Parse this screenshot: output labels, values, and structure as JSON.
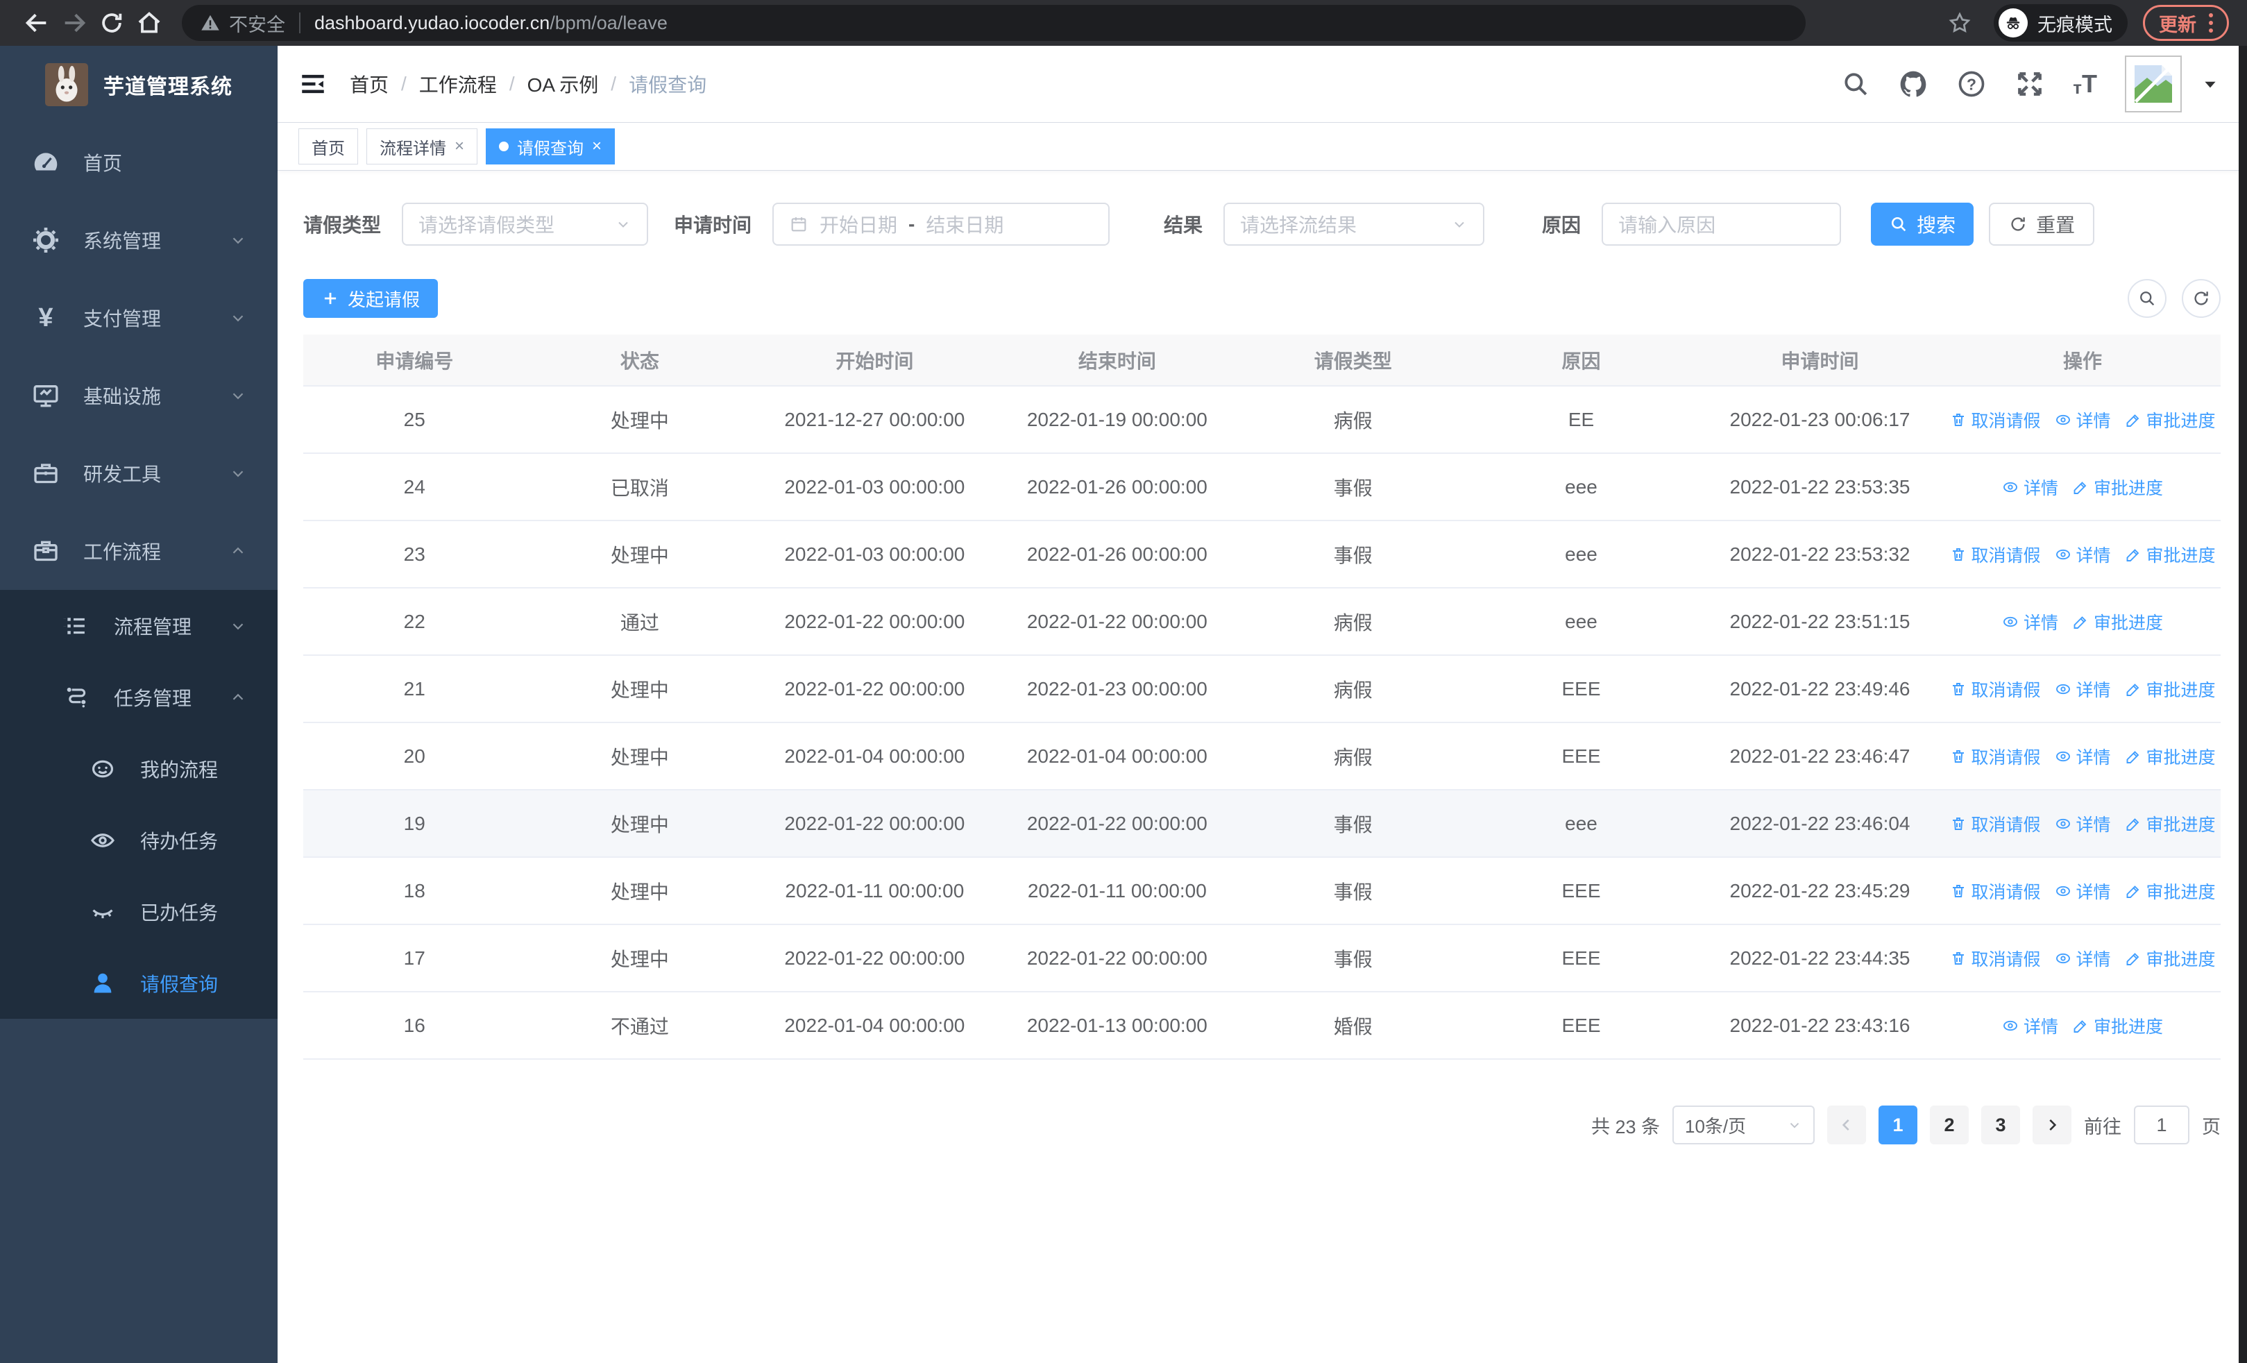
{
  "browser": {
    "security_label": "不安全",
    "url_domain": "dashboard.yudao.iocoder.cn",
    "url_path": "/bpm/oa/leave",
    "incognito_label": "无痕模式",
    "update_label": "更新"
  },
  "sidebar": {
    "title": "芋道管理系统",
    "items": [
      {
        "label": "首页",
        "icon": "dashboard-icon"
      },
      {
        "label": "系统管理",
        "icon": "gear-icon",
        "state": "collapsed"
      },
      {
        "label": "支付管理",
        "icon": "yen-icon",
        "state": "collapsed"
      },
      {
        "label": "基础设施",
        "icon": "monitor-icon",
        "state": "collapsed"
      },
      {
        "label": "研发工具",
        "icon": "toolbox-icon",
        "state": "collapsed"
      },
      {
        "label": "工作流程",
        "icon": "briefcase-icon",
        "state": "expanded"
      },
      {
        "label": "流程管理",
        "icon": "flow-list-icon",
        "state": "collapsed"
      },
      {
        "label": "任务管理",
        "icon": "org-icon",
        "state": "expanded"
      },
      {
        "label": "我的流程",
        "icon": "face-icon"
      },
      {
        "label": "待办任务",
        "icon": "eye-icon"
      },
      {
        "label": "已办任务",
        "icon": "eye-closed-icon"
      },
      {
        "label": "请假查询",
        "icon": "person-icon",
        "active": true
      }
    ]
  },
  "breadcrumb": [
    "首页",
    "工作流程",
    "OA 示例",
    "请假查询"
  ],
  "tabs": [
    {
      "label": "首页",
      "closable": false,
      "active": false
    },
    {
      "label": "流程详情",
      "closable": true,
      "active": false
    },
    {
      "label": "请假查询",
      "closable": true,
      "active": true
    }
  ],
  "close_glyph": "×",
  "filters": {
    "leave_type_label": "请假类型",
    "leave_type_placeholder": "请选择请假类型",
    "apply_time_label": "申请时间",
    "start_date_placeholder": "开始日期",
    "range_separator": "-",
    "end_date_placeholder": "结束日期",
    "result_label": "结果",
    "result_placeholder": "请选择流结果",
    "reason_label": "原因",
    "reason_placeholder": "请输入原因",
    "search_label": "搜索",
    "reset_label": "重置"
  },
  "toolbar": {
    "create_label": "发起请假"
  },
  "table": {
    "columns": [
      "申请编号",
      "状态",
      "开始时间",
      "结束时间",
      "请假类型",
      "原因",
      "申请时间",
      "操作"
    ],
    "action_labels": {
      "cancel": "取消请假",
      "detail": "详情",
      "progress": "审批进度"
    },
    "action_icons": {
      "cancel": "trash-icon",
      "detail": "view-eye-icon",
      "progress": "edit-pen-icon"
    },
    "rows": [
      {
        "id": "25",
        "status": "处理中",
        "start": "2021-12-27 00:00:00",
        "end": "2022-01-19 00:00:00",
        "type": "病假",
        "reason": "EE",
        "apply_time": "2022-01-23 00:06:17",
        "actions": [
          "cancel",
          "detail",
          "progress"
        ]
      },
      {
        "id": "24",
        "status": "已取消",
        "start": "2022-01-03 00:00:00",
        "end": "2022-01-26 00:00:00",
        "type": "事假",
        "reason": "eee",
        "apply_time": "2022-01-22 23:53:35",
        "actions": [
          "detail",
          "progress"
        ]
      },
      {
        "id": "23",
        "status": "处理中",
        "start": "2022-01-03 00:00:00",
        "end": "2022-01-26 00:00:00",
        "type": "事假",
        "reason": "eee",
        "apply_time": "2022-01-22 23:53:32",
        "actions": [
          "cancel",
          "detail",
          "progress"
        ]
      },
      {
        "id": "22",
        "status": "通过",
        "start": "2022-01-22 00:00:00",
        "end": "2022-01-22 00:00:00",
        "type": "病假",
        "reason": "eee",
        "apply_time": "2022-01-22 23:51:15",
        "actions": [
          "detail",
          "progress"
        ]
      },
      {
        "id": "21",
        "status": "处理中",
        "start": "2022-01-22 00:00:00",
        "end": "2022-01-23 00:00:00",
        "type": "病假",
        "reason": "EEE",
        "apply_time": "2022-01-22 23:49:46",
        "actions": [
          "cancel",
          "detail",
          "progress"
        ]
      },
      {
        "id": "20",
        "status": "处理中",
        "start": "2022-01-04 00:00:00",
        "end": "2022-01-04 00:00:00",
        "type": "病假",
        "reason": "EEE",
        "apply_time": "2022-01-22 23:46:47",
        "actions": [
          "cancel",
          "detail",
          "progress"
        ]
      },
      {
        "id": "19",
        "status": "处理中",
        "start": "2022-01-22 00:00:00",
        "end": "2022-01-22 00:00:00",
        "type": "事假",
        "reason": "eee",
        "apply_time": "2022-01-22 23:46:04",
        "actions": [
          "cancel",
          "detail",
          "progress"
        ],
        "highlighted": true
      },
      {
        "id": "18",
        "status": "处理中",
        "start": "2022-01-11 00:00:00",
        "end": "2022-01-11 00:00:00",
        "type": "事假",
        "reason": "EEE",
        "apply_time": "2022-01-22 23:45:29",
        "actions": [
          "cancel",
          "detail",
          "progress"
        ]
      },
      {
        "id": "17",
        "status": "处理中",
        "start": "2022-01-22 00:00:00",
        "end": "2022-01-22 00:00:00",
        "type": "事假",
        "reason": "EEE",
        "apply_time": "2022-01-22 23:44:35",
        "actions": [
          "cancel",
          "detail",
          "progress"
        ]
      },
      {
        "id": "16",
        "status": "不通过",
        "start": "2022-01-04 00:00:00",
        "end": "2022-01-13 00:00:00",
        "type": "婚假",
        "reason": "EEE",
        "apply_time": "2022-01-22 23:43:16",
        "actions": [
          "detail",
          "progress"
        ]
      }
    ]
  },
  "pagination": {
    "total_label": "共 23 条",
    "page_size": "10条/页",
    "pages": [
      "1",
      "2",
      "3"
    ],
    "active_page": "1",
    "goto_label": "前往",
    "goto_value": "1",
    "page_suffix": "页"
  },
  "colors": {
    "primary": "#409EFF",
    "sidebar_bg": "#304156",
    "submenu_bg": "#1F2D3D",
    "sidebar_text": "#BFCBD9",
    "update_red": "#EE8277"
  }
}
